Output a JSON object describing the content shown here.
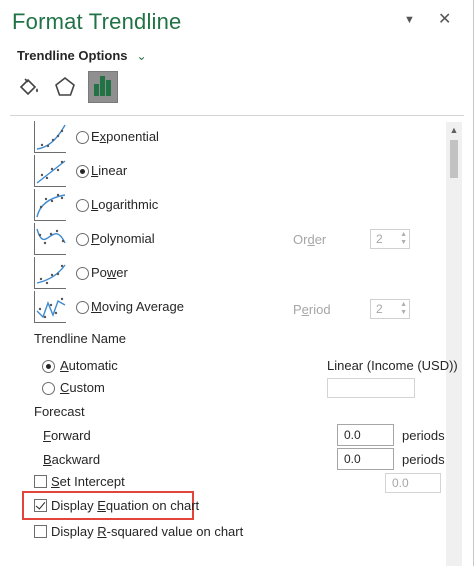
{
  "pane": {
    "title": "Format Trendline",
    "pin_icon": "pin-icon",
    "close_icon": "close-icon",
    "options_label": "Trendline Options",
    "tabs": [
      {
        "icon": "paint-bucket-icon"
      },
      {
        "icon": "pentagon-icon"
      },
      {
        "icon": "bar-chart-icon",
        "selected": true
      }
    ]
  },
  "trend_types": [
    {
      "label": "Exponential",
      "key": "x",
      "rest": "ponential",
      "pre": "E",
      "selected": false
    },
    {
      "label": "Linear",
      "pre": "",
      "key": "L",
      "rest": "inear",
      "selected": true
    },
    {
      "label": "Logarithmic",
      "pre": "",
      "key": "L",
      "rest": "ogarithmic",
      "selected": false
    },
    {
      "label": "Polynomial",
      "pre": "",
      "key": "P",
      "rest": "olynomial",
      "selected": false
    },
    {
      "label": "Power",
      "pre": "Po",
      "key": "w",
      "rest": "er",
      "selected": false
    },
    {
      "label": "Moving Average",
      "pre": "",
      "key": "M",
      "rest": "oving Average",
      "selected": false
    }
  ],
  "order": {
    "label_pre": "Or",
    "label_key": "d",
    "label_rest": "er",
    "value": "2"
  },
  "period": {
    "label_pre": "P",
    "label_key": "e",
    "label_rest": "riod",
    "value": "2"
  },
  "trendline_name": {
    "section": "Trendline Name",
    "automatic_key": "A",
    "automatic_rest": "utomatic",
    "automatic_value": "Linear (Income (USD))",
    "custom_key": "C",
    "custom_rest": "ustom",
    "custom_value": ""
  },
  "forecast": {
    "section": "Forecast",
    "forward_key": "F",
    "forward_rest": "orward",
    "forward_value": "0.0",
    "backward_key": "B",
    "backward_rest": "ackward",
    "backward_value": "0.0",
    "unit": "periods"
  },
  "intercept": {
    "key": "S",
    "rest": "et Intercept",
    "value": "0.0",
    "checked": false
  },
  "display_equation": {
    "pre": "Display ",
    "key": "E",
    "rest": "quation on chart",
    "checked": true
  },
  "display_rsquared": {
    "pre": "Display ",
    "key": "R",
    "rest": "-squared value on chart",
    "checked": false
  },
  "colors": {
    "accent": "#217346",
    "highlight": "#e0443a"
  }
}
